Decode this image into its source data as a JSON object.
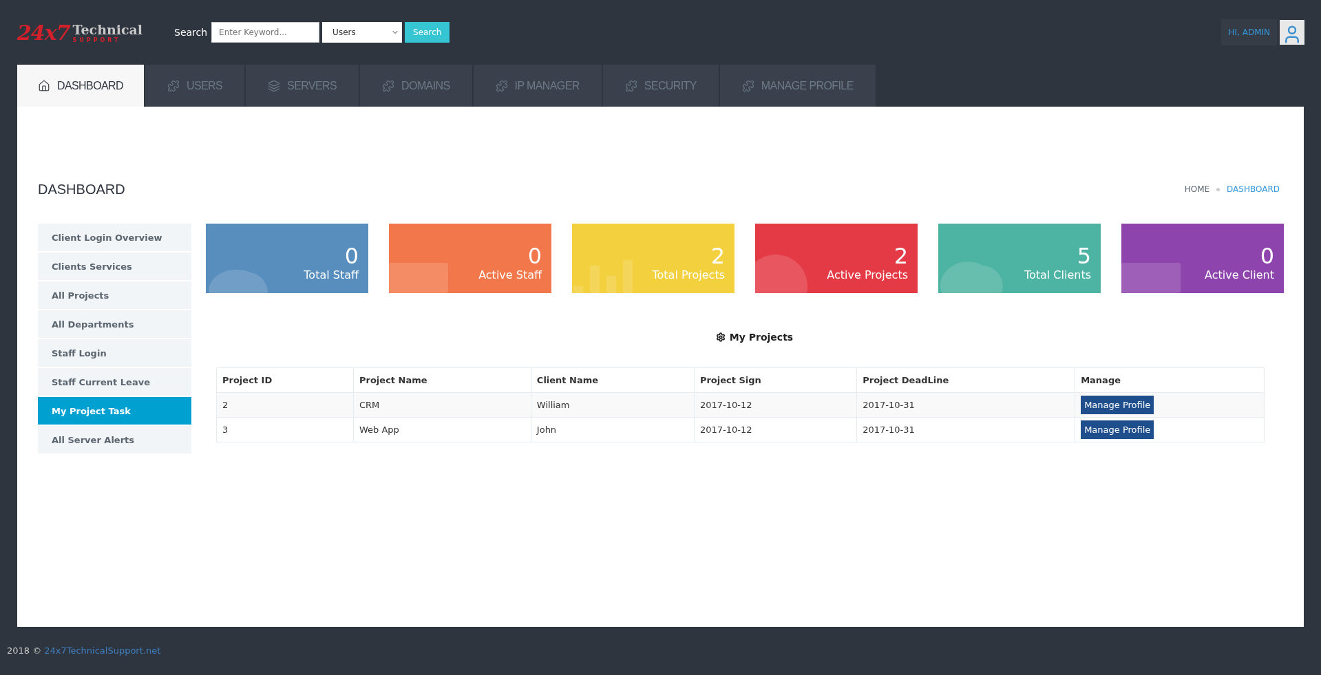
{
  "logo": {
    "number": "24x7",
    "name": "Technical",
    "tagline": "SUPPORT"
  },
  "search": {
    "label": "Search",
    "placeholder": "Enter Keyword...",
    "category": "Users",
    "button": "Search"
  },
  "user": {
    "greeting": "HI, ADMIN"
  },
  "tabs": [
    {
      "label": "DASHBOARD",
      "selected": true
    },
    {
      "label": "USERS",
      "selected": false
    },
    {
      "label": "SERVERS",
      "selected": false
    },
    {
      "label": "DOMAINS",
      "selected": false
    },
    {
      "label": "IP MANAGER",
      "selected": false
    },
    {
      "label": "SECURITY",
      "selected": false
    },
    {
      "label": "MANAGE PROFILE",
      "selected": false
    }
  ],
  "page_title": "DASHBOARD",
  "breadcrumb": [
    "HOME",
    "DASHBOARD"
  ],
  "sidebar": {
    "items": [
      {
        "label": "Client Login Overview",
        "selected": false
      },
      {
        "label": "Clients Services",
        "selected": false
      },
      {
        "label": "All Projects",
        "selected": false
      },
      {
        "label": "All Departments",
        "selected": false
      },
      {
        "label": "Staff Login",
        "selected": false
      },
      {
        "label": "Staff Current Leave",
        "selected": false
      },
      {
        "label": "My Project Task",
        "selected": true
      },
      {
        "label": "All Server Alerts",
        "selected": false
      }
    ]
  },
  "stats": [
    {
      "value": "0",
      "label": "Total Staff",
      "color": "#578ebe"
    },
    {
      "value": "0",
      "label": "Active Staff",
      "color": "#f2784b"
    },
    {
      "value": "2",
      "label": "Total Projects",
      "color": "#f3d03e"
    },
    {
      "value": "2",
      "label": "Active Projects",
      "color": "#e43a45"
    },
    {
      "value": "5",
      "label": "Total Clients",
      "color": "#4db3a2"
    },
    {
      "value": "0",
      "label": "Active Client",
      "color": "#8e44ad"
    }
  ],
  "projects": {
    "title": "My Projects",
    "columns": [
      "Project ID",
      "Project Name",
      "Client Name",
      "Project Sign",
      "Project DeadLine",
      "Manage"
    ],
    "rows": [
      {
        "cells": [
          "2",
          "CRM",
          "William",
          "2017-10-12",
          "2017-10-31"
        ],
        "action": "Manage Profile"
      },
      {
        "cells": [
          "3",
          "Web App",
          "John",
          "2017-10-12",
          "2017-10-31"
        ],
        "action": "Manage Profile"
      }
    ]
  },
  "footer": {
    "text": "2018 ©",
    "link": "24x7TechnicalSupport.net"
  }
}
